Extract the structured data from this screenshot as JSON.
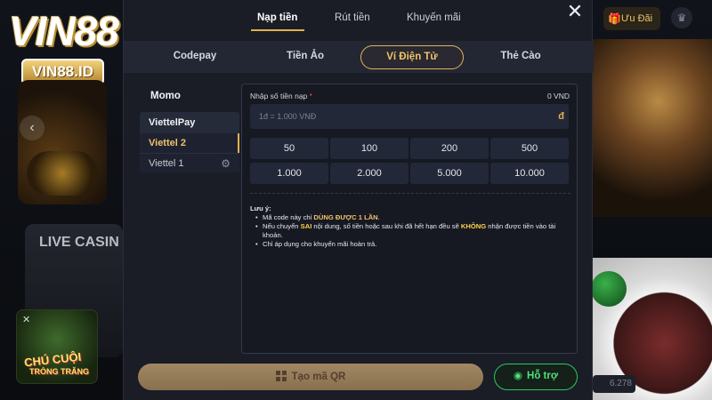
{
  "background": {
    "logo_main": "VIN88",
    "logo_sub": "VIN88.ID",
    "live_casino_label": "LIVE CASIN",
    "promo_chip_label": "Ưu Đãi",
    "game_thumb_title_1": "CHÚ CUỘI",
    "game_thumb_title_2": "TRÒNG TRĂNG",
    "right_counter": "6.278"
  },
  "modal": {
    "tabs": [
      {
        "label": "Nạp tiền",
        "active": true
      },
      {
        "label": "Rút tiền",
        "active": false
      },
      {
        "label": "Khuyến mãi",
        "active": false
      }
    ],
    "methods": [
      {
        "label": "Codepay",
        "active": false
      },
      {
        "label": "Tiền Ảo",
        "active": false
      },
      {
        "label": "Ví Điện Tử",
        "active": true
      },
      {
        "label": "Thẻ Cào",
        "active": false
      }
    ],
    "providers_title": "Momo",
    "provider_group": "ViettelPay",
    "providers": [
      {
        "label": "Viettel 2",
        "selected": true
      },
      {
        "label": "Viettel 1",
        "selected": false
      }
    ],
    "amount": {
      "label": "Nhập số tiền nạp",
      "required_mark": "*",
      "balance": "0 VND",
      "placeholder": "1đ = 1.000 VNĐ",
      "currency_symbol": "đ"
    },
    "quick_amounts": [
      "50",
      "100",
      "200",
      "500",
      "1.000",
      "2.000",
      "5.000",
      "10.000"
    ],
    "note": {
      "title": "Lưu ý:",
      "line1_prefix": "Mã code này chỉ ",
      "line1_highlight": "DÙNG ĐƯỢC 1 LẦN",
      "line1_suffix": ".",
      "line2_prefix": "Nếu chuyển ",
      "line2_warn1": "SAI",
      "line2_mid": " nội dung, số tiền hoặc sau khi đã hết hạn đều sẽ ",
      "line2_warn2": "KHÔNG",
      "line2_suffix": " nhận được tiền vào tài khoản.",
      "line3": "Chỉ áp dụng cho khuyến mãi hoàn trả."
    },
    "qr_button": "Tạo mã QR",
    "support_button": "Hỗ trợ",
    "colors": {
      "accent_gold": "#e2b04e",
      "support_green": "#2fc760",
      "panel_bg": "#1a1d26"
    }
  }
}
